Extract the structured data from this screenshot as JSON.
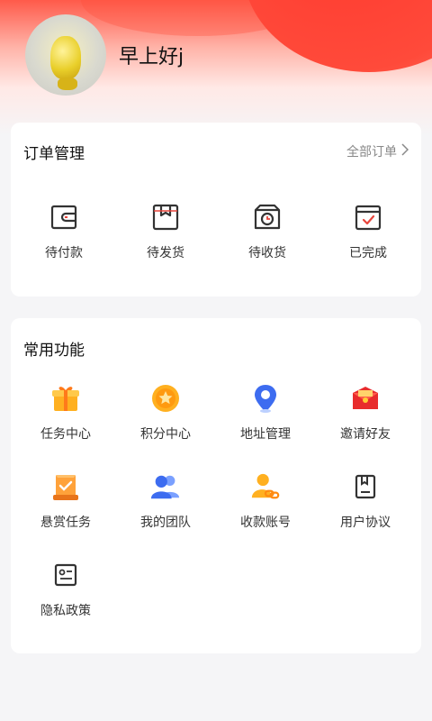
{
  "profile": {
    "greeting": "早上好j"
  },
  "orders": {
    "title": "订单管理",
    "all_label": "全部订单",
    "items": [
      {
        "label": "待付款",
        "icon": "wallet-icon"
      },
      {
        "label": "待发货",
        "icon": "package-icon"
      },
      {
        "label": "待收货",
        "icon": "delivery-box-icon"
      },
      {
        "label": "已完成",
        "icon": "calendar-check-icon"
      }
    ]
  },
  "functions": {
    "title": "常用功能",
    "items": [
      {
        "label": "任务中心",
        "icon": "gift-icon"
      },
      {
        "label": "积分中心",
        "icon": "star-coin-icon"
      },
      {
        "label": "地址管理",
        "icon": "location-pin-icon"
      },
      {
        "label": "邀请好友",
        "icon": "red-envelope-icon"
      },
      {
        "label": "悬赏任务",
        "icon": "reward-board-icon"
      },
      {
        "label": "我的团队",
        "icon": "team-icon"
      },
      {
        "label": "收款账号",
        "icon": "account-link-icon"
      },
      {
        "label": "用户协议",
        "icon": "agreement-icon"
      },
      {
        "label": "隐私政策",
        "icon": "privacy-icon"
      }
    ]
  },
  "colors": {
    "accent": "#e8453c",
    "header": "#ff3b30"
  }
}
